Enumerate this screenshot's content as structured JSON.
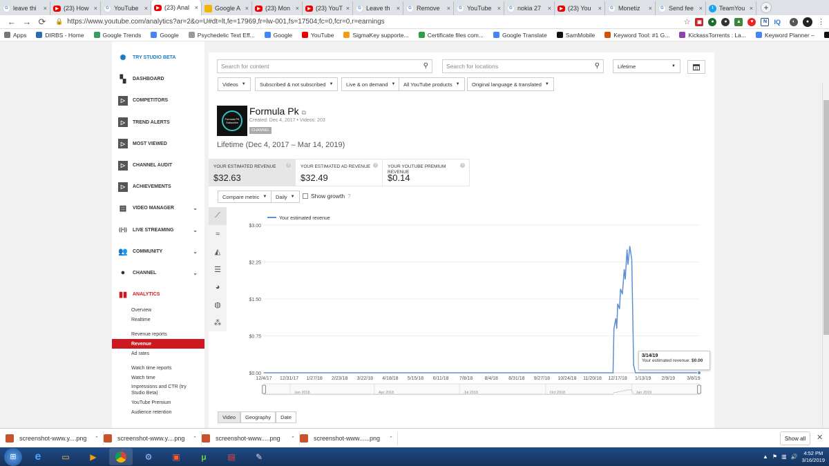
{
  "browser": {
    "tabs": [
      {
        "label": "leave thi",
        "icon": "google-icon"
      },
      {
        "label": "(23) How",
        "icon": "youtube-icon"
      },
      {
        "label": "YouTube",
        "icon": "google-icon"
      },
      {
        "label": "(23) Anal",
        "icon": "youtube-icon",
        "active": true
      },
      {
        "label": "Google A",
        "icon": "drive-icon"
      },
      {
        "label": "(23) Mon",
        "icon": "youtube-icon"
      },
      {
        "label": "(23) YouT",
        "icon": "youtube-icon"
      },
      {
        "label": "Leave th",
        "icon": "google-icon"
      },
      {
        "label": "Remove",
        "icon": "google-icon"
      },
      {
        "label": "YouTube",
        "icon": "google-icon"
      },
      {
        "label": "nokia 27",
        "icon": "google-icon"
      },
      {
        "label": "(23) You",
        "icon": "youtube-icon"
      },
      {
        "label": "Monetiz",
        "icon": "google-icon"
      },
      {
        "label": "Send fee",
        "icon": "google-icon"
      },
      {
        "label": "TeamYou",
        "icon": "twitter-icon"
      }
    ],
    "new_tab": "+",
    "url": "https://www.youtube.com/analytics?ar=2&o=U#dt=lt,fe=17969,fr=lw-001,fs=17504;fc=0,fcr=0,r=earnings",
    "bookmarks": [
      "Apps",
      "DIRBS - Home",
      "Google Trends",
      "Google",
      "Psychedelic Text Eff...",
      "Google",
      "YouTube",
      "SigmaKey supporte...",
      "Certificate files com...",
      "Google Translate",
      "SamMobile",
      "Keyword Tool: #1 G...",
      "KickassTorrents : La...",
      "Keyword Planner –",
      "Firmware download..."
    ]
  },
  "sidebar": {
    "items": [
      {
        "label": "Try Studio Beta",
        "icon": "gear-icon"
      },
      {
        "label": "Dashboard",
        "icon": "dashboard-icon"
      },
      {
        "label": "Competitors",
        "icon": "play-icon"
      },
      {
        "label": "Trend Alerts",
        "icon": "play-icon"
      },
      {
        "label": "Most Viewed",
        "icon": "play-icon"
      },
      {
        "label": "Channel Audit",
        "icon": "play-icon"
      },
      {
        "label": "Achievements",
        "icon": "play-icon"
      },
      {
        "label": "Video Manager",
        "icon": "video-manager-icon"
      },
      {
        "label": "Live Streaming",
        "icon": "live-icon"
      },
      {
        "label": "Community",
        "icon": "community-icon"
      },
      {
        "label": "Channel",
        "icon": "channel-icon"
      },
      {
        "label": "Analytics",
        "icon": "analytics-icon"
      }
    ],
    "sub_items": [
      "Overview",
      "Realtime",
      "Revenue reports",
      "Revenue",
      "Ad rates",
      "Watch time reports",
      "Watch time",
      "Impressions and CTR (try Studio Beta)",
      "YouTube Premium",
      "Audience retention"
    ]
  },
  "filters": {
    "search_content": "Search for content",
    "search_locations": "Search for locations",
    "period": "Lifetime",
    "dropdowns": [
      "Videos",
      "Subscribed & not subscribed",
      "Live & on demand",
      "All YouTube products",
      "Original language & translated"
    ]
  },
  "channel": {
    "name": "Formula Pk",
    "meta": "Created: Dec 4, 2017  •  Videos: 203",
    "badge": "CHANNEL",
    "logo_text": "Formula PK Subscribe"
  },
  "range_label": "Lifetime (Dec 4, 2017 – Mar 14, 2019)",
  "metrics": [
    {
      "label": "Your estimated revenue",
      "value": "$32.63",
      "selected": true
    },
    {
      "label": "Your estimated ad revenue",
      "value": "$32.49"
    },
    {
      "label": "Your YouTube Premium revenue",
      "value": "$0.14"
    }
  ],
  "controls": {
    "compare": "Compare metric",
    "interval": "Daily",
    "growth": "Show growth"
  },
  "chart_data": {
    "type": "line",
    "series": [
      {
        "name": "Your estimated revenue",
        "color": "#5b8ed6"
      }
    ],
    "x_ticks": [
      "12/4/17",
      "12/31/17",
      "1/27/18",
      "2/23/18",
      "3/22/18",
      "4/18/18",
      "5/15/18",
      "6/11/18",
      "7/8/18",
      "8/4/18",
      "8/31/18",
      "9/27/18",
      "10/24/18",
      "11/20/18",
      "12/17/18",
      "1/13/19",
      "2/9/19",
      "3/8/19"
    ],
    "y_ticks": [
      "$0.00",
      "$0.75",
      "$1.50",
      "$2.25",
      "$3.00"
    ],
    "ylim": [
      0,
      3.0
    ],
    "points": [
      {
        "x": "12/4/17",
        "y": 0
      },
      {
        "x": "12/12/18",
        "y": 0
      },
      {
        "x": "12/13/18",
        "y": 0.9
      },
      {
        "x": "12/15/18",
        "y": 1.1
      },
      {
        "x": "12/16/18",
        "y": 0.9
      },
      {
        "x": "12/17/18",
        "y": 1.4
      },
      {
        "x": "12/19/18",
        "y": 1.3
      },
      {
        "x": "12/20/18",
        "y": 1.7
      },
      {
        "x": "12/22/18",
        "y": 1.6
      },
      {
        "x": "12/24/18",
        "y": 2.1
      },
      {
        "x": "12/25/18",
        "y": 1.9
      },
      {
        "x": "12/27/18",
        "y": 2.5
      },
      {
        "x": "12/28/18",
        "y": 2.2
      },
      {
        "x": "12/30/18",
        "y": 2.57
      },
      {
        "x": "1/1/19",
        "y": 2.3
      },
      {
        "x": "1/3/19",
        "y": 0.15
      },
      {
        "x": "1/5/19",
        "y": 0
      },
      {
        "x": "3/14/19",
        "y": 0
      }
    ],
    "navigator_labels": [
      "Jan 2018",
      "Apr 2018",
      "Jul 2018",
      "Oct 2018",
      "Jan 2019"
    ],
    "tooltip": {
      "date": "3/14/19",
      "label": "Your estimated revenue:",
      "value": "$0.00"
    }
  },
  "bottom_tabs": [
    "Video",
    "Geography",
    "Date"
  ],
  "downloads": {
    "files": [
      "screenshot-www.y....png",
      "screenshot-www.y....png",
      "screenshot-www.....png",
      "screenshot-www......png"
    ],
    "show_all": "Show all"
  },
  "taskbar": {
    "time": "4:52 PM",
    "date": "3/16/2019"
  }
}
